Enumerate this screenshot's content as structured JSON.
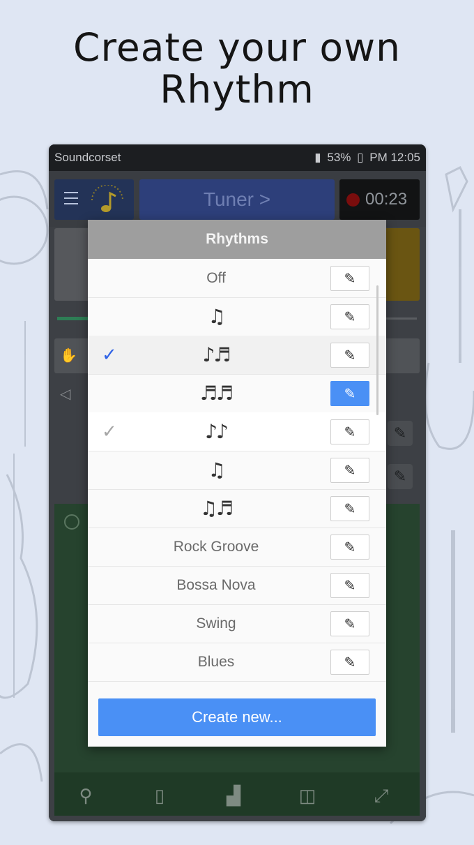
{
  "headline": {
    "line1": "Create your own",
    "line2": "Rhythm"
  },
  "status_bar": {
    "carrier": "Soundcorset",
    "battery": "53%",
    "time": "PM 12:05"
  },
  "app_bar": {
    "tuner_label": "Tuner >",
    "timer": "00:23"
  },
  "dialog": {
    "title": "Rhythms",
    "rows": [
      {
        "label": "Off",
        "check": "",
        "edit_label": "✎"
      },
      {
        "label": "♫",
        "check": "",
        "edit_label": "✎"
      },
      {
        "label": "♪♬",
        "check": "✓",
        "edit_label": "✎"
      },
      {
        "label": "♬♬",
        "check": "",
        "edit_label": "✎"
      },
      {
        "label": "♪♪",
        "check": "✓",
        "edit_label": "✎"
      },
      {
        "label": "♫",
        "check": "",
        "edit_label": "✎"
      },
      {
        "label": "♫♬",
        "check": "",
        "edit_label": "✎"
      },
      {
        "label": "Rock Groove",
        "check": "",
        "edit_label": "✎"
      },
      {
        "label": "Bossa Nova",
        "check": "",
        "edit_label": "✎"
      },
      {
        "label": "Swing",
        "check": "",
        "edit_label": "✎"
      },
      {
        "label": "Blues",
        "check": "",
        "edit_label": "✎"
      }
    ],
    "create_label": "Create new..."
  },
  "colors": {
    "accent": "#4a90f5",
    "check_blue": "#2e62e6",
    "panel_green": "#26432e"
  },
  "icons": {
    "menu": "menu-icon",
    "edit": "pencil-icon",
    "bottom_nav": [
      "flashlight-icon",
      "vibrate-icon",
      "stats-icon",
      "recorder-icon",
      "fullscreen-icon"
    ]
  }
}
